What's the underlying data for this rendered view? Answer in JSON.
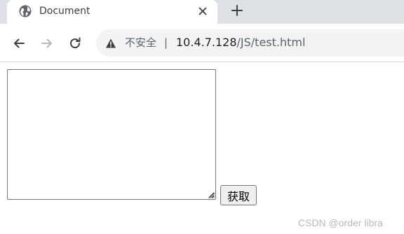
{
  "browser": {
    "tab": {
      "title": "Document",
      "favicon": "globe-icon",
      "close_icon": "close-icon"
    },
    "new_tab_icon": "plus-icon",
    "nav": {
      "back_icon": "arrow-left-icon",
      "forward_icon": "arrow-right-icon",
      "reload_icon": "reload-icon"
    },
    "omnibox": {
      "security_icon": "warning-icon",
      "security_label": "不安全",
      "separator": "|",
      "url_host": "10.4.7.128",
      "url_path": "/JS/test.html"
    }
  },
  "page": {
    "textarea_value": "",
    "fetch_button_label": "获取"
  },
  "watermark": "CSDN @order libra",
  "colors": {
    "tabstrip_bg": "#dee1e6",
    "omnibox_bg": "#f1f3f4",
    "button_bg": "#efefef"
  }
}
